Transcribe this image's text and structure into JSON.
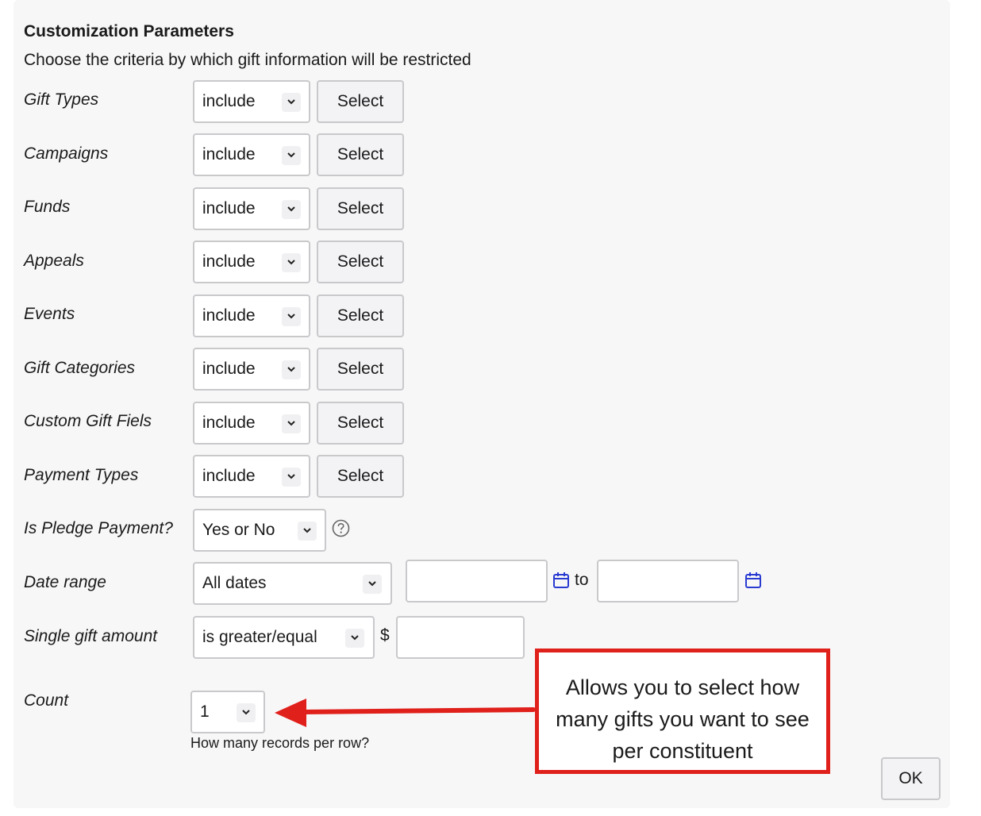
{
  "header": {
    "title": "Customization Parameters",
    "subtitle": "Choose the criteria by which gift information will be restricted"
  },
  "filters": [
    {
      "label": "Gift Types",
      "mode": "include",
      "button": "Select"
    },
    {
      "label": "Campaigns",
      "mode": "include",
      "button": "Select"
    },
    {
      "label": "Funds",
      "mode": "include",
      "button": "Select"
    },
    {
      "label": "Appeals",
      "mode": "include",
      "button": "Select"
    },
    {
      "label": "Events",
      "mode": "include",
      "button": "Select"
    },
    {
      "label": "Gift Categories",
      "mode": "include",
      "button": "Select"
    },
    {
      "label": "Custom Gift Fiels",
      "mode": "include",
      "button": "Select"
    },
    {
      "label": "Payment Types",
      "mode": "include",
      "button": "Select"
    }
  ],
  "pledge": {
    "label": "Is Pledge Payment?",
    "value": "Yes or No",
    "help_icon": "question-circle-icon"
  },
  "date_range": {
    "label": "Date range",
    "value": "All dates",
    "start": "",
    "end": "",
    "to_label": "to",
    "calendar_icon": "calendar-icon"
  },
  "amount": {
    "label": "Single gift amount",
    "comparator": "is greater/equal",
    "currency": "$",
    "value": ""
  },
  "count": {
    "label": "Count",
    "value": "1",
    "hint": "How many records per row?"
  },
  "annotation": {
    "line1": "Allows you to select how",
    "line2": "many gifts you want to see",
    "line3": "per constituent",
    "color": "#e0201b"
  },
  "actions": {
    "ok": "OK"
  }
}
